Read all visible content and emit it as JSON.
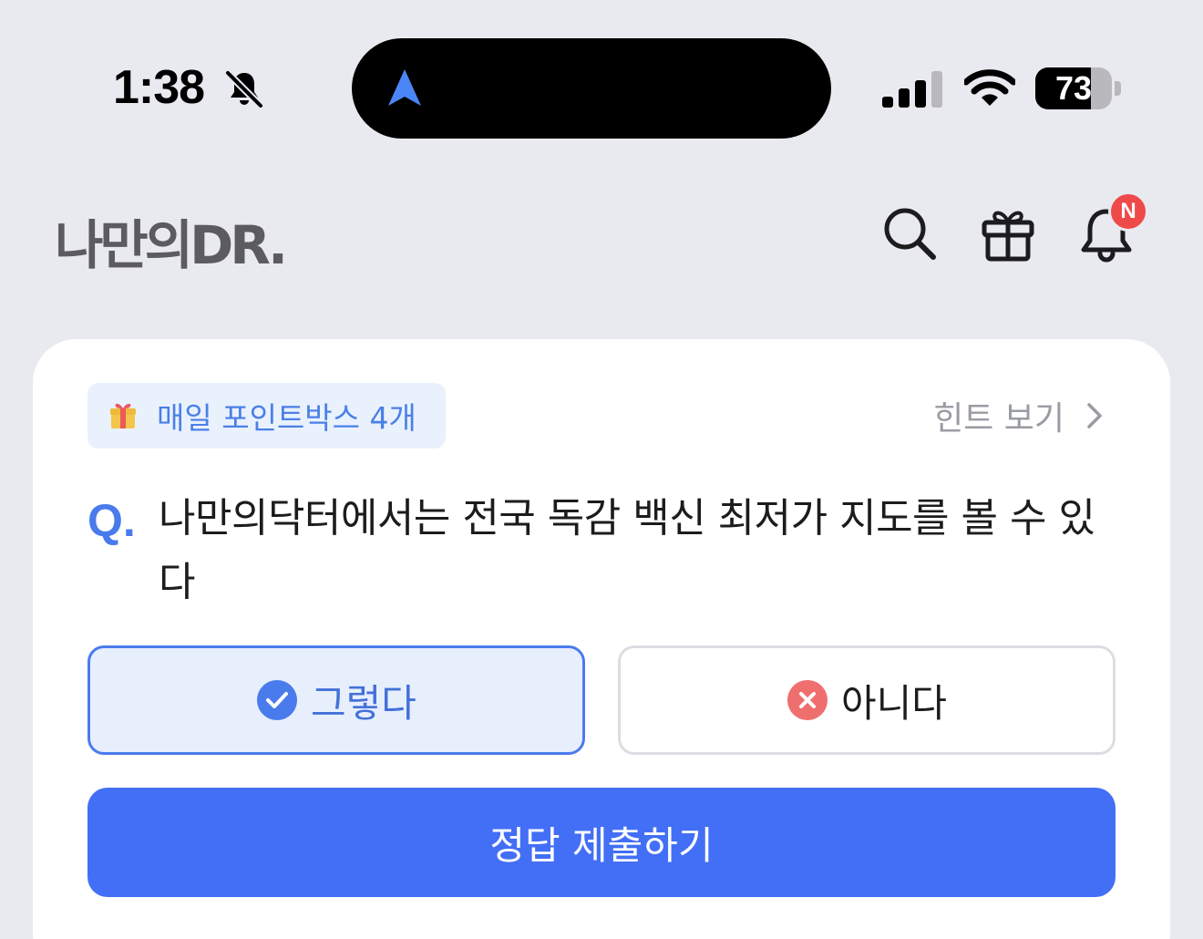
{
  "status_bar": {
    "time": "1:38",
    "battery_level": "73",
    "battery_fraction": 0.73,
    "cellular_bars": 3,
    "icons": [
      "bell-slash-icon",
      "location-arrow-icon",
      "cellular-signal-icon",
      "wifi-icon",
      "battery-icon"
    ]
  },
  "header": {
    "logo_text": "나만의DR.",
    "icons": [
      "search-icon",
      "gift-icon",
      "bell-icon"
    ],
    "notification_badge": "N"
  },
  "quiz_card": {
    "point_box_label": "매일 포인트박스 4개",
    "hint_label": "힌트 보기",
    "question_marker": "Q.",
    "question": "나만의닥터에서는 전국 독감 백신 최저가 지도를 볼 수 있다",
    "options": [
      {
        "label": "그렇다",
        "selected": true,
        "icon": "check-circle-icon"
      },
      {
        "label": "아니다",
        "selected": false,
        "icon": "x-circle-icon"
      }
    ],
    "submit_label": "정답 제출하기"
  },
  "colors": {
    "background": "#e9eaf0",
    "accent": "#436ff6",
    "selected_bg": "#e7effd",
    "danger": "#ef6f6f",
    "badge": "#ef4a4a",
    "hint_gray": "#9a9ca3"
  }
}
